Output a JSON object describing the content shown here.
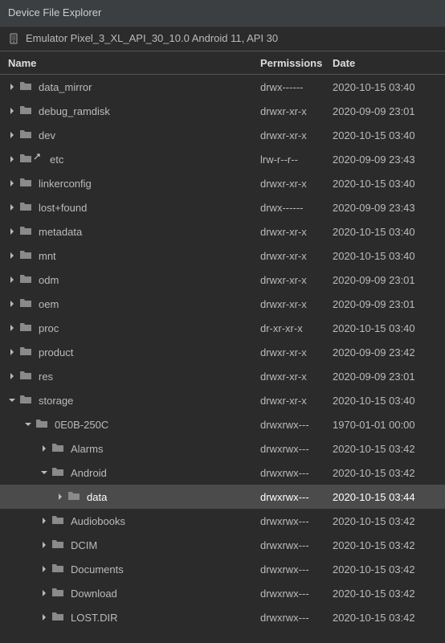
{
  "panel": {
    "title": "Device File Explorer"
  },
  "device": {
    "label": "Emulator Pixel_3_XL_API_30_10.0 Android 11, API 30"
  },
  "columns": {
    "name": "Name",
    "permissions": "Permissions",
    "date": "Date"
  },
  "rows": [
    {
      "depth": 0,
      "expanded": false,
      "link": false,
      "selected": false,
      "name": "data_mirror",
      "perm": "drwx------",
      "date": "2020-10-15 03:40"
    },
    {
      "depth": 0,
      "expanded": false,
      "link": false,
      "selected": false,
      "name": "debug_ramdisk",
      "perm": "drwxr-xr-x",
      "date": "2020-09-09 23:01"
    },
    {
      "depth": 0,
      "expanded": false,
      "link": false,
      "selected": false,
      "name": "dev",
      "perm": "drwxr-xr-x",
      "date": "2020-10-15 03:40"
    },
    {
      "depth": 0,
      "expanded": false,
      "link": true,
      "selected": false,
      "name": "etc",
      "perm": "lrw-r--r--",
      "date": "2020-09-09 23:43"
    },
    {
      "depth": 0,
      "expanded": false,
      "link": false,
      "selected": false,
      "name": "linkerconfig",
      "perm": "drwxr-xr-x",
      "date": "2020-10-15 03:40"
    },
    {
      "depth": 0,
      "expanded": false,
      "link": false,
      "selected": false,
      "name": "lost+found",
      "perm": "drwx------",
      "date": "2020-09-09 23:43"
    },
    {
      "depth": 0,
      "expanded": false,
      "link": false,
      "selected": false,
      "name": "metadata",
      "perm": "drwxr-xr-x",
      "date": "2020-10-15 03:40"
    },
    {
      "depth": 0,
      "expanded": false,
      "link": false,
      "selected": false,
      "name": "mnt",
      "perm": "drwxr-xr-x",
      "date": "2020-10-15 03:40"
    },
    {
      "depth": 0,
      "expanded": false,
      "link": false,
      "selected": false,
      "name": "odm",
      "perm": "drwxr-xr-x",
      "date": "2020-09-09 23:01"
    },
    {
      "depth": 0,
      "expanded": false,
      "link": false,
      "selected": false,
      "name": "oem",
      "perm": "drwxr-xr-x",
      "date": "2020-09-09 23:01"
    },
    {
      "depth": 0,
      "expanded": false,
      "link": false,
      "selected": false,
      "name": "proc",
      "perm": "dr-xr-xr-x",
      "date": "2020-10-15 03:40"
    },
    {
      "depth": 0,
      "expanded": false,
      "link": false,
      "selected": false,
      "name": "product",
      "perm": "drwxr-xr-x",
      "date": "2020-09-09 23:42"
    },
    {
      "depth": 0,
      "expanded": false,
      "link": false,
      "selected": false,
      "name": "res",
      "perm": "drwxr-xr-x",
      "date": "2020-09-09 23:01"
    },
    {
      "depth": 0,
      "expanded": true,
      "link": false,
      "selected": false,
      "name": "storage",
      "perm": "drwxr-xr-x",
      "date": "2020-10-15 03:40"
    },
    {
      "depth": 1,
      "expanded": true,
      "link": false,
      "selected": false,
      "name": "0E0B-250C",
      "perm": "drwxrwx---",
      "date": "1970-01-01 00:00"
    },
    {
      "depth": 2,
      "expanded": false,
      "link": false,
      "selected": false,
      "name": "Alarms",
      "perm": "drwxrwx---",
      "date": "2020-10-15 03:42"
    },
    {
      "depth": 2,
      "expanded": true,
      "link": false,
      "selected": false,
      "name": "Android",
      "perm": "drwxrwx---",
      "date": "2020-10-15 03:42"
    },
    {
      "depth": 3,
      "expanded": false,
      "link": false,
      "selected": true,
      "name": "data",
      "perm": "drwxrwx---",
      "date": "2020-10-15 03:44"
    },
    {
      "depth": 2,
      "expanded": false,
      "link": false,
      "selected": false,
      "name": "Audiobooks",
      "perm": "drwxrwx---",
      "date": "2020-10-15 03:42"
    },
    {
      "depth": 2,
      "expanded": false,
      "link": false,
      "selected": false,
      "name": "DCIM",
      "perm": "drwxrwx---",
      "date": "2020-10-15 03:42"
    },
    {
      "depth": 2,
      "expanded": false,
      "link": false,
      "selected": false,
      "name": "Documents",
      "perm": "drwxrwx---",
      "date": "2020-10-15 03:42"
    },
    {
      "depth": 2,
      "expanded": false,
      "link": false,
      "selected": false,
      "name": "Download",
      "perm": "drwxrwx---",
      "date": "2020-10-15 03:42"
    },
    {
      "depth": 2,
      "expanded": false,
      "link": false,
      "selected": false,
      "name": "LOST.DIR",
      "perm": "drwxrwx---",
      "date": "2020-10-15 03:42"
    }
  ]
}
